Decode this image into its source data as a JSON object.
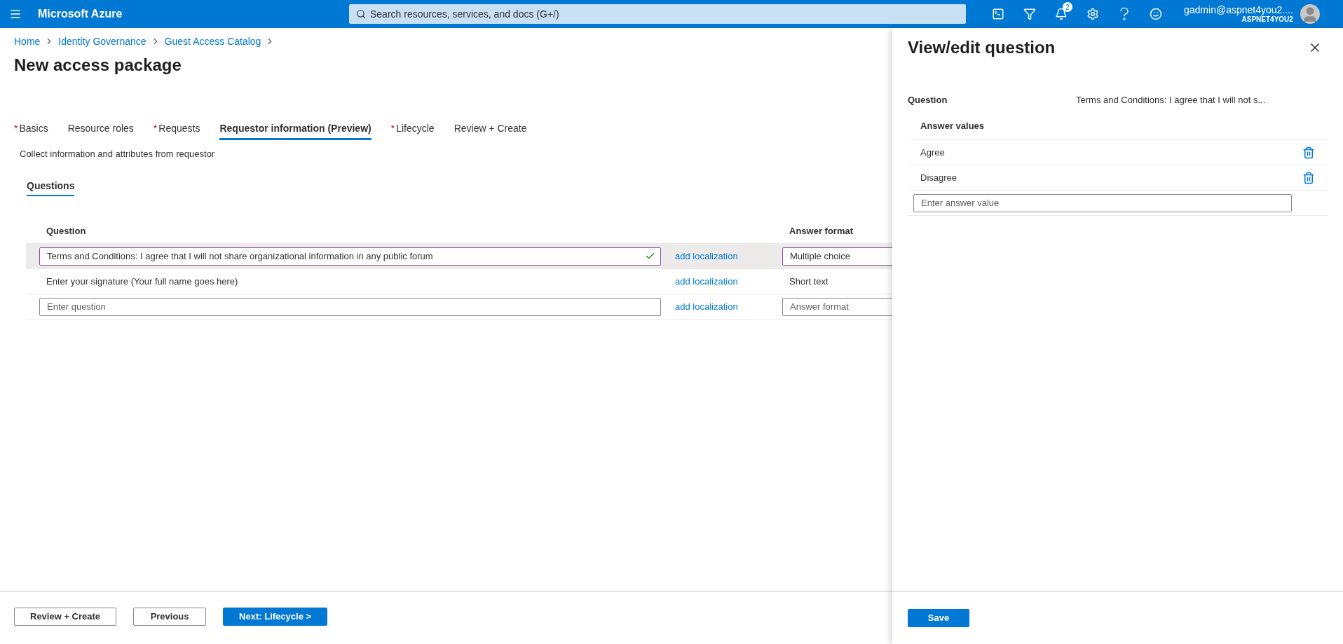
{
  "topbar": {
    "brand": "Microsoft Azure",
    "search_placeholder": "Search resources, services, and docs (G+/)",
    "notification_count": "2",
    "user_name": "gadmin@aspnet4you2....",
    "tenant": "ASPNET4YOU2"
  },
  "breadcrumb": [
    "Home",
    "Identity Governance",
    "Guest Access Catalog"
  ],
  "title": "New access package",
  "tabs": [
    {
      "label": "Basics",
      "required": true,
      "selected": false
    },
    {
      "label": "Resource roles",
      "required": false,
      "selected": false
    },
    {
      "label": "Requests",
      "required": true,
      "selected": false
    },
    {
      "label": "Requestor information (Preview)",
      "required": false,
      "selected": true
    },
    {
      "label": "Lifecycle",
      "required": true,
      "selected": false
    },
    {
      "label": "Review + Create",
      "required": false,
      "selected": false
    }
  ],
  "required_mark": "*",
  "description": "Collect information and attributes from requestor",
  "subtabs": [
    {
      "label": "Questions",
      "selected": true
    }
  ],
  "table": {
    "columns": [
      "Question",
      "Answer format"
    ],
    "rows": [
      {
        "kind": "field",
        "question": "Terms and Conditions: I agree that I will not share organizational information in any public forum",
        "valid": true,
        "localization": "add localization",
        "answer_format": "Multiple choice",
        "selected": true
      },
      {
        "kind": "text",
        "question": "Enter your signature (Your full name goes here)",
        "localization": "add localization",
        "answer_format": "Short text",
        "selected": false
      },
      {
        "kind": "new",
        "question_placeholder": "Enter question",
        "localization": "add localization",
        "answer_format_placeholder": "Answer format",
        "selected": false
      }
    ]
  },
  "footer_buttons": [
    {
      "label": "Review + Create",
      "kind": "secondary"
    },
    {
      "label": "Previous",
      "kind": "secondary"
    },
    {
      "label": "Next: Lifecycle >",
      "kind": "primary"
    }
  ],
  "panel": {
    "title": "View/edit question",
    "question_label": "Question",
    "question_value": "Terms and Conditions: I agree that I will not s...",
    "answer_values_header": "Answer values",
    "answers": [
      "Agree",
      "Disagree"
    ],
    "answer_placeholder": "Enter answer value",
    "save": "Save"
  }
}
